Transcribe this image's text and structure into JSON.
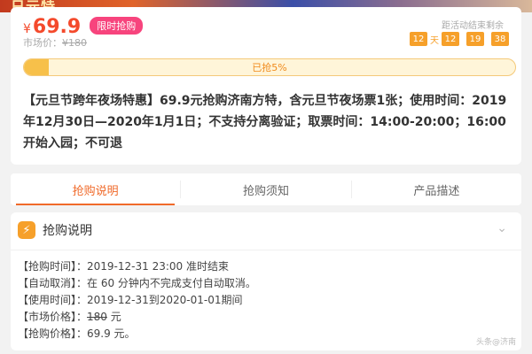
{
  "banner": {
    "text": "日元特"
  },
  "price": {
    "currency": "¥",
    "value": "69.9",
    "badge": "限时抢购",
    "market_label": "市场价：",
    "market_value": "¥180"
  },
  "countdown": {
    "label": "距活动结束剩余",
    "days": "12",
    "days_unit": "天",
    "hours": "12",
    "minutes": "19",
    "seconds": "38"
  },
  "progress": {
    "text": "已抢5%",
    "percent": 5
  },
  "description": "【元旦节跨年夜场特惠】69.9元抢购济南方特，含元旦节夜场票1张；使用时间：2019年12月30日—2020年1月1日；不支持分离验证；取票时间：14:00-20:00；16:00开始入园；不可退",
  "tabs": [
    "抢购说明",
    "抢购须知",
    "产品描述"
  ],
  "info": {
    "title": "抢购说明",
    "rows": [
      {
        "key": "【抢购时间】：",
        "value": "2019-12-31 23:00 准时结束"
      },
      {
        "key": "【自动取消】：",
        "value": "在 60 分钟内不完成支付自动取消。"
      },
      {
        "key": "【使用时间】：",
        "value": "2019-12-31到2020-01-01期间"
      },
      {
        "key": "【市场价格】：",
        "value_strike": "180",
        "value_suffix": " 元"
      },
      {
        "key": "【抢购价格】：",
        "value": "69.9 元。"
      }
    ]
  },
  "watermark": "头条@济南"
}
